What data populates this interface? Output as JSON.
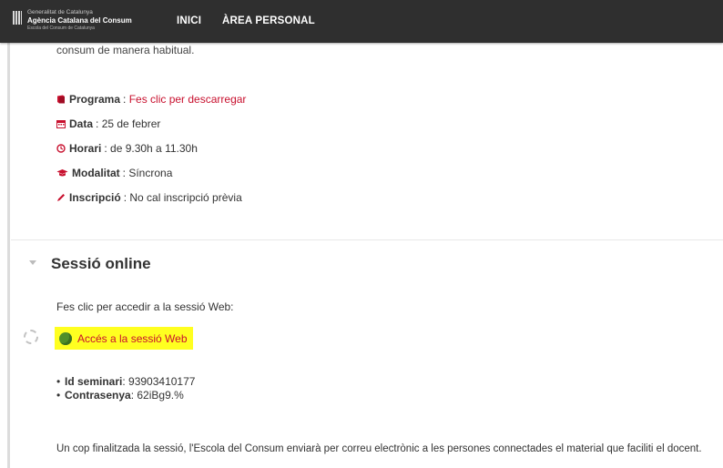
{
  "header": {
    "logo_line1": "Generalitat de Catalunya",
    "logo_line2": "Agència Catalana del Consum",
    "logo_line3": "Escola del Consum de Catalunya",
    "nav": [
      "INICI",
      "ÀREA PERSONAL"
    ]
  },
  "content": {
    "intro_snippet": "consum de manera habitual.",
    "info": {
      "programa_label": "Programa",
      "programa_value": "Fes clic per descarregar",
      "data_label": "Data",
      "data_value": "25 de febrer",
      "horari_label": "Horari",
      "horari_value": "de 9.30h a 11.30h",
      "modalitat_label": "Modalitat",
      "modalitat_value": "Síncrona",
      "inscripcio_label": "Inscripció",
      "inscripcio_value": "No cal inscripció prèvia"
    },
    "section_title": "Sessió online",
    "session_description": "Fes clic per accedir a la sessió Web:",
    "session_link": "Accés a la sessió Web",
    "details": {
      "id_label": "Id seminari",
      "id_value": "93903410177",
      "pass_label": "Contrasenya",
      "pass_value": "62iBg9.%"
    },
    "footer_text": "Un cop finalitzada la sessió, l'Escola del Consum enviarà per correu electrònic a les persones connectades el material que faciliti el docent."
  },
  "colors": {
    "accent": "#c8102e",
    "highlight": "#ffff20",
    "topbar": "#2f2f2f"
  }
}
